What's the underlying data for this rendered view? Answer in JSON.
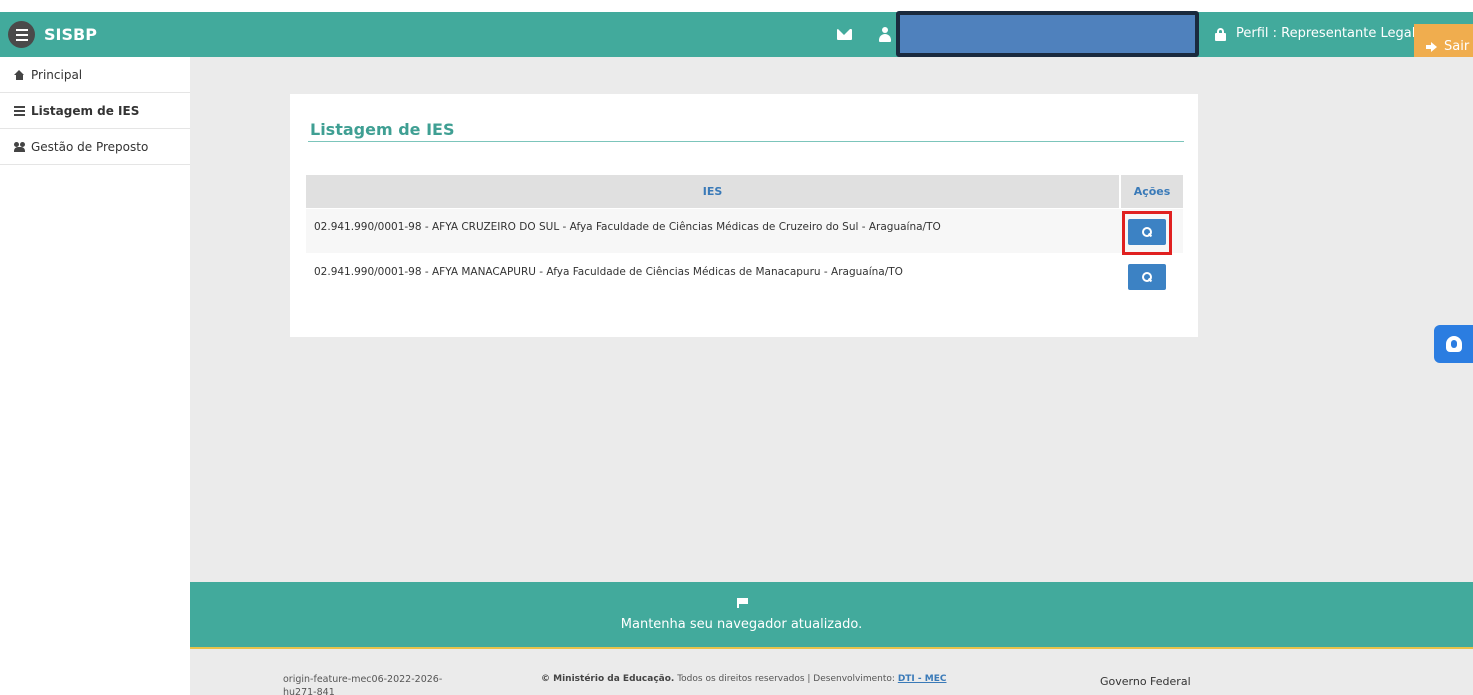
{
  "header": {
    "brand": "SISBP",
    "profile_label": "Perfil : Representante Legal",
    "logout_label": "Sair"
  },
  "sidebar": {
    "items": [
      {
        "label": "Principal",
        "icon": "home-icon"
      },
      {
        "label": "Listagem de IES",
        "icon": "list-icon"
      },
      {
        "label": "Gestão de Preposto",
        "icon": "users-icon"
      }
    ]
  },
  "main": {
    "title": "Listagem de IES",
    "table": {
      "columns": [
        "IES",
        "Ações"
      ],
      "rows": [
        "02.941.990/0001-98 - AFYA CRUZEIRO DO SUL - Afya Faculdade de Ciências Médicas de Cruzeiro do Sul - Araguaína/TO",
        "02.941.990/0001-98 - AFYA MANACAPURU - Afya Faculdade de Ciências Médicas de Manacapuru - Araguaína/TO"
      ]
    }
  },
  "footer": {
    "banner_message": "Mantenha seu navegador atualizado.",
    "version": "origin-feature-mec06-2022-2026-hu271-841",
    "copyright_org": "© Ministério da Educação.",
    "copyright_text": " Todos os direitos reservados | Desenvolvimento: ",
    "copyright_dev": "DTI - MEC",
    "gov_label": "Governo Federal"
  },
  "colors": {
    "header_bg": "#42aa9c",
    "accent_text": "#3f9f93",
    "logout_bg": "#f0ad4e",
    "action_button": "#3c82c4",
    "highlight_border": "#e02020"
  }
}
